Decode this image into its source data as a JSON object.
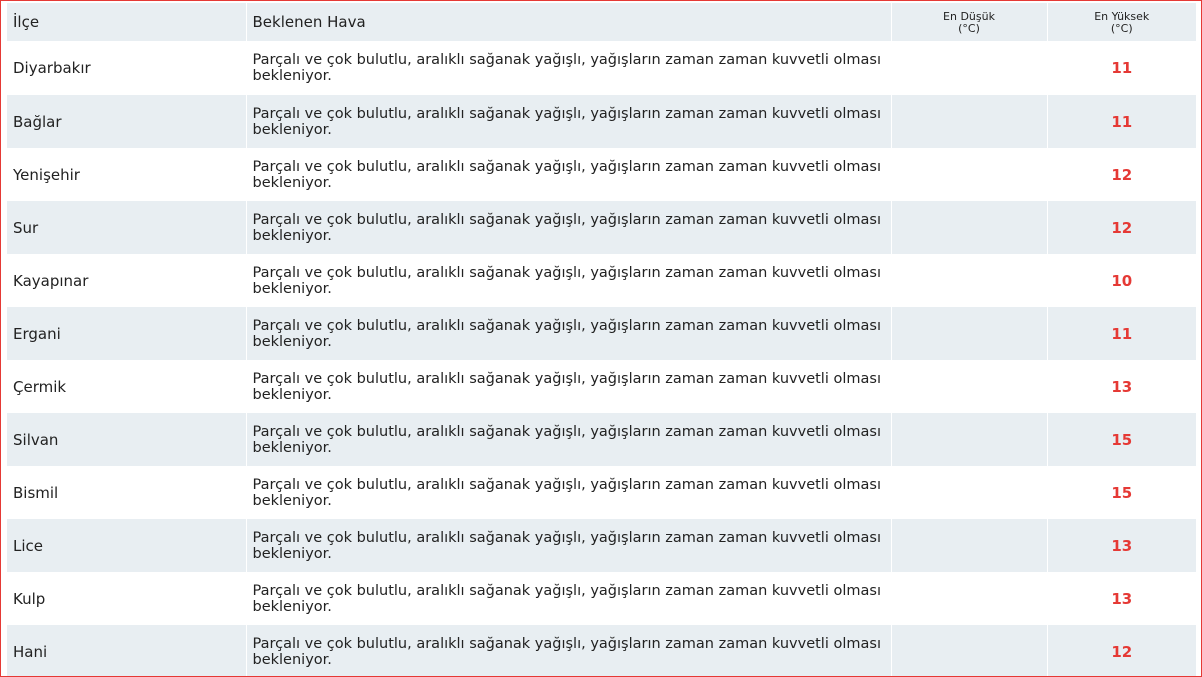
{
  "headers": {
    "district": "İlçe",
    "forecast": "Beklenen Hava",
    "min_line1": "En Düşük",
    "min_line2": "(°C)",
    "max_line1": "En Yüksek",
    "max_line2": "(°C)"
  },
  "rows": [
    {
      "district": "Diyarbakır",
      "forecast": "Parçalı ve çok bulutlu, aralıklı sağanak yağışlı, yağışların zaman zaman kuvvetli olması bekleniyor.",
      "min": "",
      "max": "11"
    },
    {
      "district": "Bağlar",
      "forecast": "Parçalı ve çok bulutlu, aralıklı sağanak yağışlı, yağışların zaman zaman kuvvetli olması bekleniyor.",
      "min": "",
      "max": "11"
    },
    {
      "district": "Yenişehir",
      "forecast": "Parçalı ve çok bulutlu, aralıklı sağanak yağışlı, yağışların zaman zaman kuvvetli olması bekleniyor.",
      "min": "",
      "max": "12"
    },
    {
      "district": "Sur",
      "forecast": "Parçalı ve çok bulutlu, aralıklı sağanak yağışlı, yağışların zaman zaman kuvvetli olması bekleniyor.",
      "min": "",
      "max": "12"
    },
    {
      "district": "Kayapınar",
      "forecast": "Parçalı ve çok bulutlu, aralıklı sağanak yağışlı, yağışların zaman zaman kuvvetli olması bekleniyor.",
      "min": "",
      "max": "10"
    },
    {
      "district": "Ergani",
      "forecast": "Parçalı ve çok bulutlu, aralıklı sağanak yağışlı, yağışların zaman zaman kuvvetli olması bekleniyor.",
      "min": "",
      "max": "11"
    },
    {
      "district": "Çermik",
      "forecast": "Parçalı ve çok bulutlu, aralıklı sağanak yağışlı, yağışların zaman zaman kuvvetli olması bekleniyor.",
      "min": "",
      "max": "13"
    },
    {
      "district": "Silvan",
      "forecast": "Parçalı ve çok bulutlu, aralıklı sağanak yağışlı, yağışların zaman zaman kuvvetli olması bekleniyor.",
      "min": "",
      "max": "15"
    },
    {
      "district": "Bismil",
      "forecast": "Parçalı ve çok bulutlu, aralıklı sağanak yağışlı, yağışların zaman zaman kuvvetli olması bekleniyor.",
      "min": "",
      "max": "15"
    },
    {
      "district": "Lice",
      "forecast": "Parçalı ve çok bulutlu, aralıklı sağanak yağışlı, yağışların zaman zaman kuvvetli olması bekleniyor.",
      "min": "",
      "max": "13"
    },
    {
      "district": "Kulp",
      "forecast": "Parçalı ve çok bulutlu, aralıklı sağanak yağışlı, yağışların zaman zaman kuvvetli olması bekleniyor.",
      "min": "",
      "max": "13"
    },
    {
      "district": "Hani",
      "forecast": "Parçalı ve çok bulutlu, aralıklı sağanak yağışlı, yağışların zaman zaman kuvvetli olması bekleniyor.",
      "min": "",
      "max": "12"
    }
  ],
  "colors": {
    "max_temp": "#e53935",
    "row_alt_bg": "#e8eef2",
    "frame_border": "#e53935"
  }
}
